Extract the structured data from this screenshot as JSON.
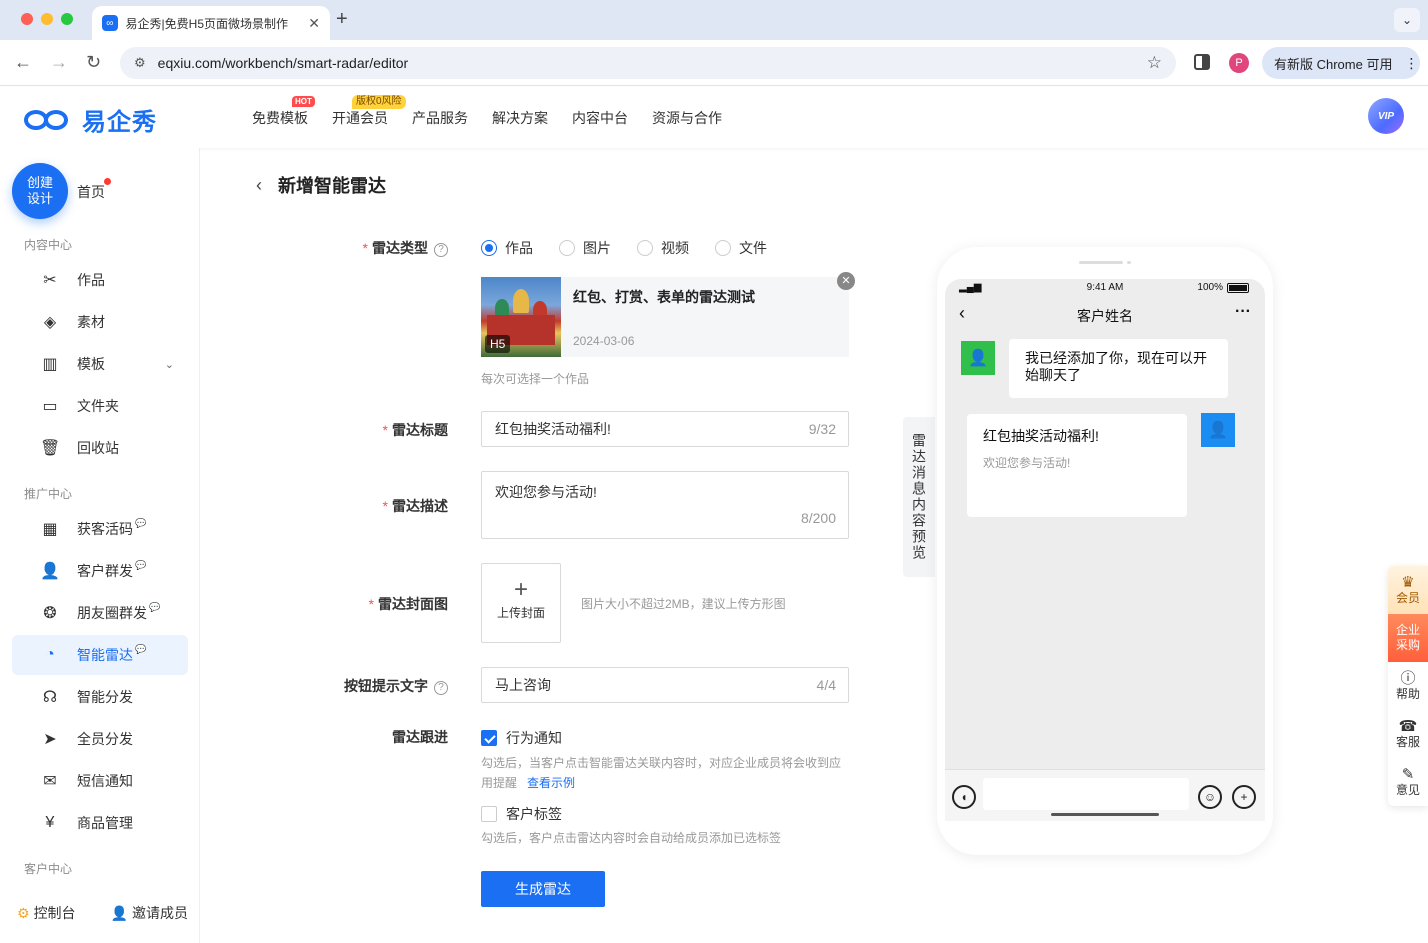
{
  "browser": {
    "tab_title": "易企秀|免费H5页面微场景制作",
    "tab_close": "✕",
    "new_tab": "+",
    "url": "eqxiu.com/workbench/smart-radar/editor",
    "update_button": "有新版 Chrome 可用",
    "profile_initial": "P"
  },
  "header": {
    "logo_text": "易企秀",
    "nav": [
      {
        "label": "免费模板",
        "badge": "HOT"
      },
      {
        "label": "开通会员",
        "badge": "版权0风险"
      },
      {
        "label": "产品服务"
      },
      {
        "label": "解决方案"
      },
      {
        "label": "内容中台"
      },
      {
        "label": "资源与合作"
      }
    ],
    "vip_label": "VIP"
  },
  "sidebar": {
    "create_label": "创建设计",
    "home": "首页",
    "sections": {
      "content": "内容中心",
      "promotion": "推广中心",
      "customer": "客户中心"
    },
    "content_items": [
      "作品",
      "素材",
      "模板",
      "文件夹",
      "回收站"
    ],
    "promo_items": [
      "获客活码",
      "客户群发",
      "朋友圈群发",
      "智能雷达",
      "智能分发",
      "全员分发",
      "短信通知",
      "商品管理"
    ],
    "footer_console": "控制台",
    "footer_invite": "邀请成员"
  },
  "form": {
    "page_title": "新增智能雷达",
    "type_label": "雷达类型",
    "type_options": [
      "作品",
      "图片",
      "视频",
      "文件"
    ],
    "selected_type": "作品",
    "work_title": "红包、打赏、表单的雷达测试",
    "work_date": "2024-03-06",
    "work_badge": "H5",
    "work_hint": "每次可选择一个作品",
    "title_label": "雷达标题",
    "title_value": "红包抽奖活动福利!",
    "title_count": "9/32",
    "desc_label": "雷达描述",
    "desc_value": "欢迎您参与活动!",
    "desc_count": "8/200",
    "cover_label": "雷达封面图",
    "upload_label": "上传封面",
    "cover_hint": "图片大小不超过2MB，建议上传方形图",
    "button_text_label": "按钮提示文字",
    "button_text_value": "马上咨询",
    "button_text_count": "4/4",
    "follow_label": "雷达跟进",
    "behavior_notify": "行为通知",
    "behavior_notify_checked": true,
    "behavior_hint_1": "勾选后，当客户点击智能雷达关联内容时，对应企业成员将会收到应",
    "behavior_hint_2": "用提醒",
    "view_example": "查看示例",
    "customer_tag": "客户标签",
    "customer_tag_checked": false,
    "tag_hint": "勾选后，客户点击雷达内容时会自动给成员添加已选标签",
    "submit": "生成雷达"
  },
  "preview": {
    "tab_label": "雷达消息内容预览",
    "time": "9:41 AM",
    "battery": "100%",
    "chat_title": "客户姓名",
    "more": "···",
    "msg_text": "我已经添加了你，现在可以开始聊天了",
    "card_title": "红包抽奖活动福利!",
    "card_desc": "欢迎您参与活动!"
  },
  "float_bar": {
    "vip": "会员",
    "enterprise": "企业采购",
    "help": "帮助",
    "service": "客服",
    "feedback": "意见"
  },
  "colors": {
    "primary": "#1a6ff2",
    "danger": "#ff4d4f"
  }
}
